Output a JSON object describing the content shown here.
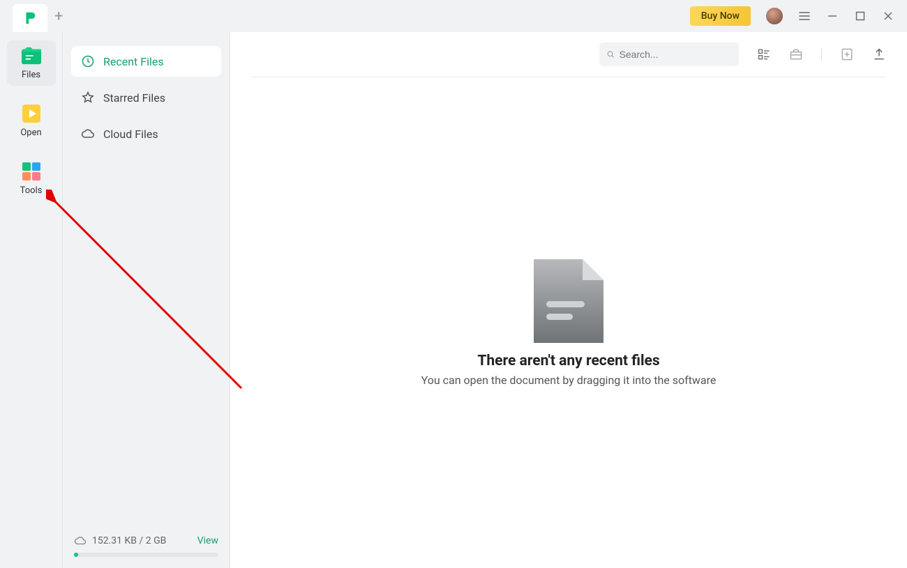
{
  "titlebar": {
    "buy_now": "Buy Now"
  },
  "leftnav": {
    "files": "Files",
    "open": "Open",
    "tools": "Tools"
  },
  "midnav": {
    "recent": "Recent Files",
    "starred": "Starred Files",
    "cloud": "Cloud Files"
  },
  "storage": {
    "text": "152.31 KB / 2 GB",
    "view": "View"
  },
  "search": {
    "placeholder": "Search..."
  },
  "empty": {
    "title": "There aren't any recent files",
    "subtitle": "You can open the document by dragging it into the software"
  }
}
